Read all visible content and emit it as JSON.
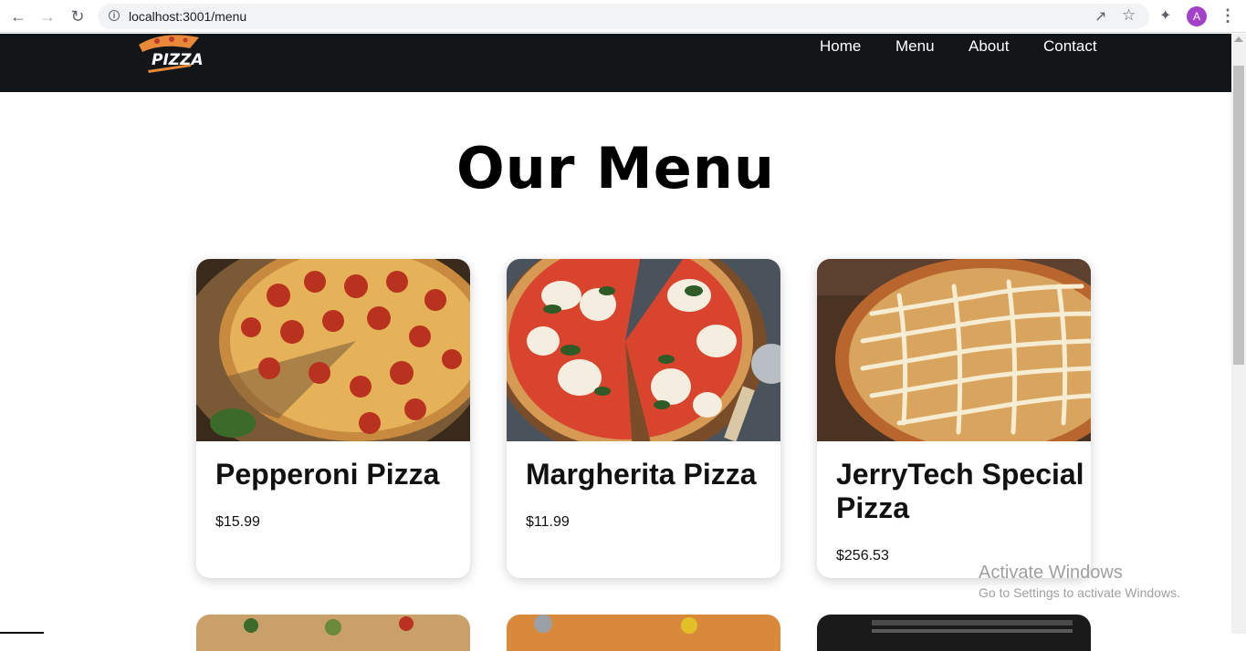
{
  "browser": {
    "url": "localhost:3001/menu",
    "avatar_letter": "A"
  },
  "site": {
    "nav": [
      "Home",
      "Menu",
      "About",
      "Contact"
    ],
    "logo_text": "PIZZA"
  },
  "page": {
    "title": "Our Menu"
  },
  "menu_items": [
    {
      "name": "Pepperoni Pizza",
      "price": "$15.99"
    },
    {
      "name": "Margherita Pizza",
      "price": "$11.99"
    },
    {
      "name": "JerryTech Special Pizza",
      "price": "$256.53"
    }
  ],
  "watermark": {
    "title": "Activate Windows",
    "subtitle": "Go to Settings to activate Windows."
  },
  "colors": {
    "header_bg": "#121619",
    "avatar_bg": "#a142c9"
  }
}
